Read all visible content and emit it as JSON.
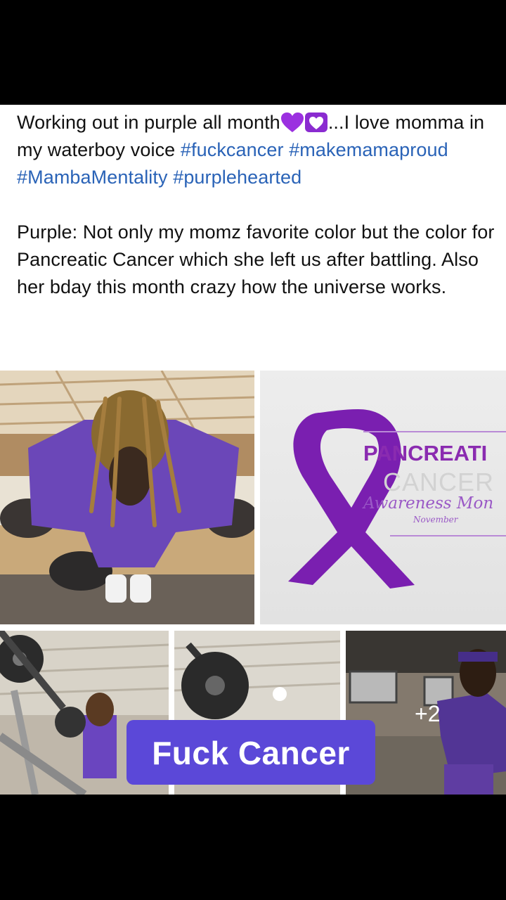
{
  "post": {
    "caption_parts": {
      "text_1": "Working out in purple all month",
      "emoji_1": "purple-heart",
      "emoji_2": "heart-with-ribbon",
      "text_2": "...I love momma in my waterboy voice ",
      "hashtag_1": "#fuckcancer",
      "hashtag_2": "#makemamaproud",
      "hashtag_3": "#MambaMentality",
      "hashtag_4": "#purplehearted"
    },
    "paragraph_2": "Purple: Not only my momz favorite color but the color for Pancreatic Cancer which she left us after battling. Also her bday this month crazy how the universe works."
  },
  "photos": {
    "awareness_graphic": {
      "title": "PANCREATI",
      "subtitle": "CANCER",
      "script": "Awareness Mon",
      "month": "November"
    },
    "more_count": "+2"
  },
  "sticker": {
    "text": "Fuck Cancer"
  },
  "colors": {
    "hashtag": "#2a63b7",
    "sticker_bg": "#5b48d8",
    "ribbon": "#7a1fb0"
  }
}
